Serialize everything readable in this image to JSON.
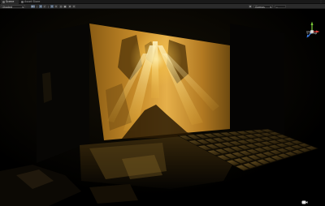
{
  "tabs": [
    {
      "label": "Scene",
      "icon": "hash-icon",
      "active": true
    },
    {
      "label": "Asset Store",
      "icon": "store-icon",
      "active": false
    }
  ],
  "toolbar": {
    "shading_mode": "Shaded",
    "mode_2d": "2D",
    "gizmos_label": "Gizmos",
    "search_icon": "search-icon",
    "more_icon": "kebab-menu-icon"
  },
  "gizmo": {
    "projection_label": "< Persp",
    "y_axis_color": "#7ccc3a",
    "x_axis_color": "#e0403a",
    "z_axis_color": "#3a7ae0"
  },
  "colors": {
    "background": "#000000",
    "tab_bar": "#191919",
    "toolbar": "#2b2b2b",
    "light_gold": "#f2c040",
    "screen_base": "#b07f22"
  }
}
